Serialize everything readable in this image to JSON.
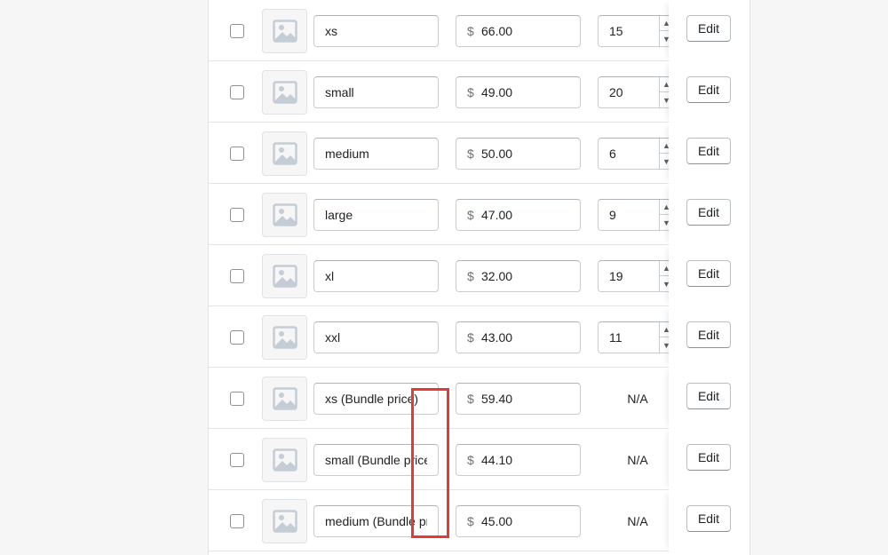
{
  "variants": [
    {
      "name": "xs",
      "currency": "$",
      "price": "66.00",
      "quantity": "15",
      "edit_label": "Edit"
    },
    {
      "name": "small",
      "currency": "$",
      "price": "49.00",
      "quantity": "20",
      "edit_label": "Edit"
    },
    {
      "name": "medium",
      "currency": "$",
      "price": "50.00",
      "quantity": "6",
      "edit_label": "Edit"
    },
    {
      "name": "large",
      "currency": "$",
      "price": "47.00",
      "quantity": "9",
      "edit_label": "Edit"
    },
    {
      "name": "xl",
      "currency": "$",
      "price": "32.00",
      "quantity": "19",
      "edit_label": "Edit"
    },
    {
      "name": "xxl",
      "currency": "$",
      "price": "43.00",
      "quantity": "11",
      "edit_label": "Edit"
    },
    {
      "name": "xs (Bundle price)",
      "currency": "$",
      "price": "59.40",
      "quantity_text": "N/A",
      "edit_label": "Edit"
    },
    {
      "name": "small (Bundle price)",
      "currency": "$",
      "price": "44.10",
      "quantity_text": "N/A",
      "edit_label": "Edit"
    },
    {
      "name": "medium (Bundle price)",
      "currency": "$",
      "price": "45.00",
      "quantity_text": "N/A",
      "edit_label": "Edit"
    }
  ],
  "icons": {
    "thumbnail": "image-placeholder-icon",
    "stepper_up": "chevron-up-icon",
    "stepper_down": "chevron-down-icon"
  },
  "colors": {
    "highlight": "#e53935",
    "border": "#c9cccf",
    "page_bg": "#f6f6f7"
  }
}
